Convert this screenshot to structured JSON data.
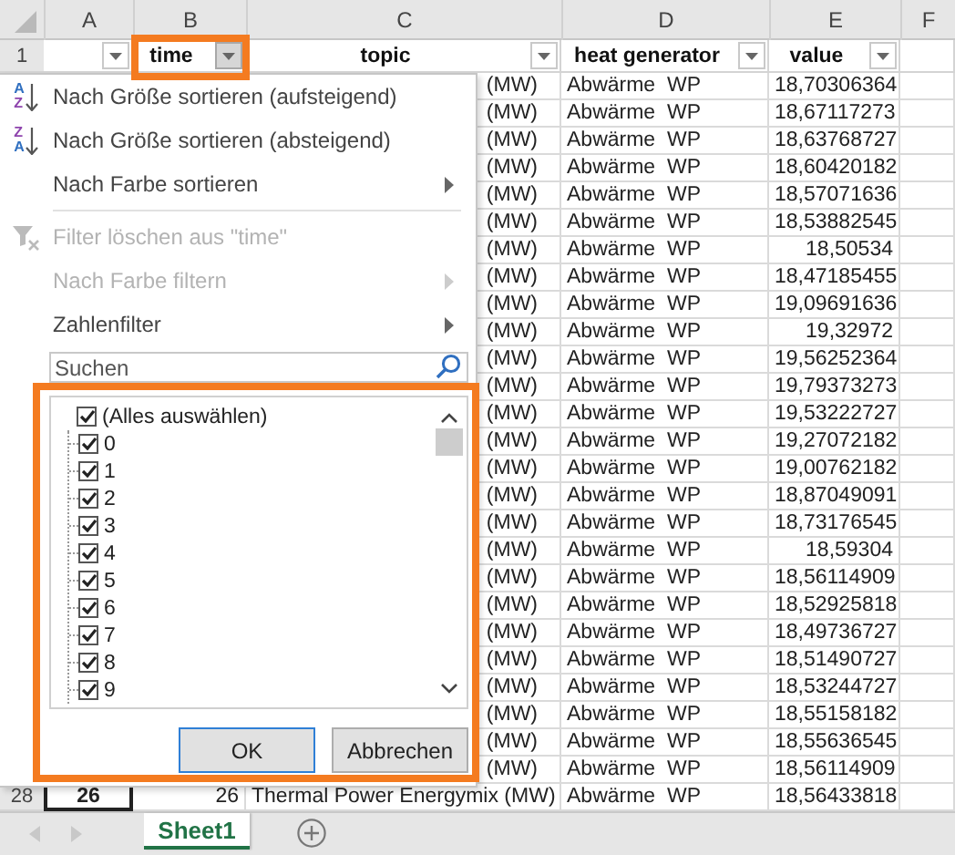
{
  "columns": [
    {
      "letter": "A",
      "filter_open": false
    },
    {
      "letter": "B",
      "header": "time",
      "filter_open": true
    },
    {
      "letter": "C",
      "header": "topic",
      "filter_open": false
    },
    {
      "letter": "D",
      "header": "heat generator",
      "filter_open": false
    },
    {
      "letter": "E",
      "header": "value",
      "filter_open": false
    },
    {
      "letter": "F"
    }
  ],
  "header_row": "1",
  "rows": [
    {
      "cells": {
        "C": "(MW)",
        "D": "Abwärme  WP",
        "E": "18,70306364"
      }
    },
    {
      "cells": {
        "C": "(MW)",
        "D": "Abwärme  WP",
        "E": "18,67117273"
      }
    },
    {
      "cells": {
        "C": "(MW)",
        "D": "Abwärme  WP",
        "E": "18,63768727"
      }
    },
    {
      "cells": {
        "C": "(MW)",
        "D": "Abwärme  WP",
        "E": "18,60420182"
      }
    },
    {
      "cells": {
        "C": "(MW)",
        "D": "Abwärme  WP",
        "E": "18,57071636"
      }
    },
    {
      "cells": {
        "C": "(MW)",
        "D": "Abwärme  WP",
        "E": "18,53882545"
      }
    },
    {
      "cells": {
        "C": "(MW)",
        "D": "Abwärme  WP",
        "E": "18,50534"
      }
    },
    {
      "cells": {
        "C": "(MW)",
        "D": "Abwärme  WP",
        "E": "18,47185455"
      }
    },
    {
      "cells": {
        "C": "(MW)",
        "D": "Abwärme  WP",
        "E": "19,09691636"
      }
    },
    {
      "cells": {
        "C": "(MW)",
        "D": "Abwärme  WP",
        "E": "19,32972"
      }
    },
    {
      "cells": {
        "C": "(MW)",
        "D": "Abwärme  WP",
        "E": "19,56252364"
      }
    },
    {
      "cells": {
        "C": "(MW)",
        "D": "Abwärme  WP",
        "E": "19,79373273"
      }
    },
    {
      "cells": {
        "C": "(MW)",
        "D": "Abwärme  WP",
        "E": "19,53222727"
      }
    },
    {
      "cells": {
        "C": "(MW)",
        "D": "Abwärme  WP",
        "E": "19,27072182"
      }
    },
    {
      "cells": {
        "C": "(MW)",
        "D": "Abwärme  WP",
        "E": "19,00762182"
      }
    },
    {
      "cells": {
        "C": "(MW)",
        "D": "Abwärme  WP",
        "E": "18,87049091"
      }
    },
    {
      "cells": {
        "C": "(MW)",
        "D": "Abwärme  WP",
        "E": "18,73176545"
      }
    },
    {
      "cells": {
        "C": "(MW)",
        "D": "Abwärme  WP",
        "E": "18,59304"
      }
    },
    {
      "cells": {
        "C": "(MW)",
        "D": "Abwärme  WP",
        "E": "18,56114909"
      }
    },
    {
      "cells": {
        "C": "(MW)",
        "D": "Abwärme  WP",
        "E": "18,52925818"
      }
    },
    {
      "cells": {
        "C": "(MW)",
        "D": "Abwärme  WP",
        "E": "18,49736727"
      }
    },
    {
      "cells": {
        "C": "(MW)",
        "D": "Abwärme  WP",
        "E": "18,51490727"
      }
    },
    {
      "cells": {
        "C": "(MW)",
        "D": "Abwärme  WP",
        "E": "18,53244727"
      }
    },
    {
      "cells": {
        "C": "(MW)",
        "D": "Abwärme  WP",
        "E": "18,55158182"
      }
    },
    {
      "cells": {
        "C": "(MW)",
        "D": "Abwärme  WP",
        "E": "18,55636545"
      }
    },
    {
      "cells": {
        "C": "(MW)",
        "D": "Abwärme  WP",
        "E": "18,56114909"
      }
    },
    {
      "header": "28",
      "cells": {
        "A": {
          "text": "26",
          "selected": true
        },
        "B": {
          "text": "26",
          "selected": false
        },
        "C": {
          "text": "Thermal Power Energymix (MW)",
          "selected": false
        },
        "D": {
          "text": "Abwärme  WP",
          "selected": false
        },
        "E": {
          "text": "18,56433818",
          "selected": false
        }
      }
    }
  ],
  "filter_menu": {
    "items": [
      {
        "kind": "sort",
        "label": "Nach Größe sortieren (aufsteigend)",
        "icon_letters": [
          "A",
          "Z"
        ],
        "disabled": false,
        "submenu": false
      },
      {
        "kind": "sort",
        "label": "Nach Größe sortieren (absteigend)",
        "icon_letters": [
          "Z",
          "A"
        ],
        "disabled": false,
        "submenu": false
      },
      {
        "kind": "command",
        "label": "Nach Farbe sortieren",
        "disabled": false,
        "submenu": true
      },
      {
        "kind": "separator"
      },
      {
        "kind": "clear",
        "label": "Filter löschen aus \"time\"",
        "disabled": true,
        "submenu": false
      },
      {
        "kind": "command",
        "label": "Nach Farbe filtern",
        "disabled": true,
        "submenu": true
      },
      {
        "kind": "command",
        "label": "Zahlenfilter",
        "disabled": false,
        "submenu": true
      }
    ],
    "search": {
      "placeholder": "Suchen"
    },
    "values": [
      {
        "label": "(Alles auswählen)",
        "checked": true,
        "children": [
          {
            "label": "0",
            "checked": true
          },
          {
            "label": "1",
            "checked": true
          },
          {
            "label": "2",
            "checked": true
          },
          {
            "label": "3",
            "checked": true
          },
          {
            "label": "4",
            "checked": true
          },
          {
            "label": "5",
            "checked": true
          },
          {
            "label": "6",
            "checked": true
          },
          {
            "label": "7",
            "checked": true
          },
          {
            "label": "8",
            "checked": true
          },
          {
            "label": "9",
            "checked": true
          }
        ]
      }
    ],
    "buttons": [
      {
        "label": "OK",
        "default": true
      },
      {
        "label": "Abbrechen",
        "default": false
      }
    ]
  },
  "sheet_tabs": [
    {
      "label": "Sheet1",
      "selected": true
    }
  ]
}
